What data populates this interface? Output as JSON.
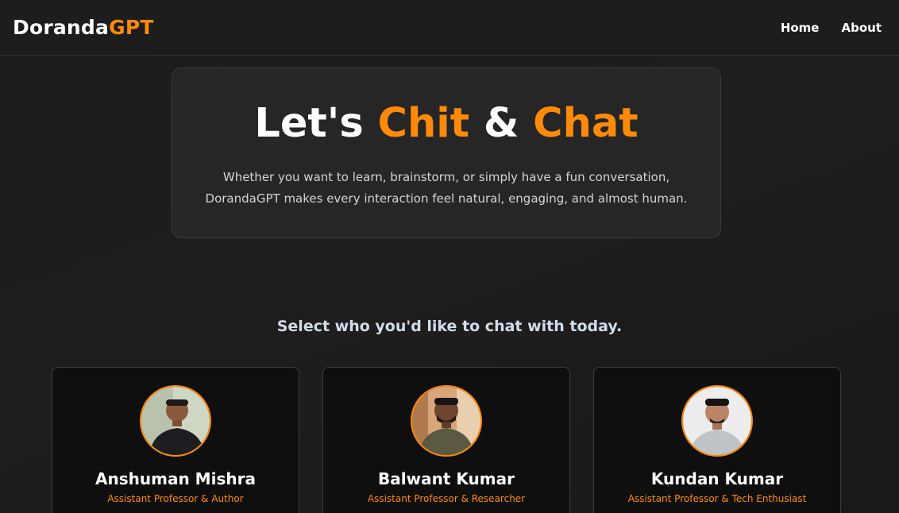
{
  "nav": {
    "brand_main": "Doranda",
    "brand_accent": "GPT",
    "links": [
      "Home",
      "About"
    ]
  },
  "hero": {
    "title_part1": "Let's ",
    "title_accent1": "Chit",
    "title_part2": " & ",
    "title_accent2": "Chat",
    "description": "Whether you want to learn, brainstorm, or simply have a fun conversation, DorandaGPT makes every interaction feel natural, engaging, and almost human."
  },
  "section": {
    "title": "Select who you'd like to chat with today."
  },
  "people": [
    {
      "name": "Anshuman Mishra",
      "role": "Assistant Professor & Author"
    },
    {
      "name": "Balwant Kumar",
      "role": "Assistant Professor & Researcher"
    },
    {
      "name": "Kundan Kumar",
      "role": "Assistant Professor & Tech Enthusiast"
    }
  ],
  "colors": {
    "accent": "#ff8a0a",
    "background": "#1b1b1b",
    "card": "#0f0f10"
  }
}
